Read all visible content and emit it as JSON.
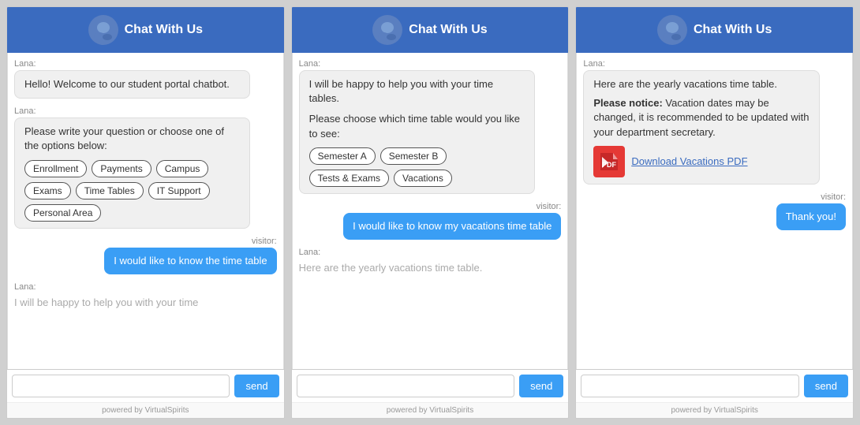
{
  "header": {
    "title": "Chat With Us"
  },
  "panel1": {
    "lana_label1": "Lana:",
    "msg1": "Hello! Welcome to our student portal chatbot.",
    "lana_label2": "Lana:",
    "msg2": "Please write your question or choose one of the options below:",
    "options": [
      "Enrollment",
      "Payments",
      "Campus",
      "Exams",
      "Time Tables",
      "IT Support",
      "Personal Area"
    ],
    "visitor_label": "visitor:",
    "visitor_msg": "I would like to know the time table",
    "lana_label3": "Lana:",
    "fade_msg": "I will be happy to help you with your time"
  },
  "panel2": {
    "lana_label1": "Lana:",
    "msg1": "I will be happy to help you with your time tables.",
    "msg2": "Please choose which time table would you like to see:",
    "options": [
      "Semester A",
      "Semester B",
      "Tests & Exams",
      "Vacations"
    ],
    "visitor_label": "visitor:",
    "visitor_msg": "I would like to know my vacations time table",
    "lana_label2": "Lana:",
    "fade_msg": "Here are the yearly vacations time table."
  },
  "panel3": {
    "lana_label1": "Lana:",
    "msg1": "Here are the yearly vacations time table.",
    "notice_prefix": "Please notice:",
    "notice_body": " Vacation dates may be changed, it is recommended to be updated with your department secretary.",
    "pdf_link_text": "Download Vacations PDF",
    "visitor_label": "visitor:",
    "visitor_msg": "Thank you!",
    "powered_by": "powered by VirtualSpirits"
  },
  "common": {
    "powered_by": "powered by VirtualSpirits",
    "send_label": "send",
    "input_placeholder": ""
  }
}
